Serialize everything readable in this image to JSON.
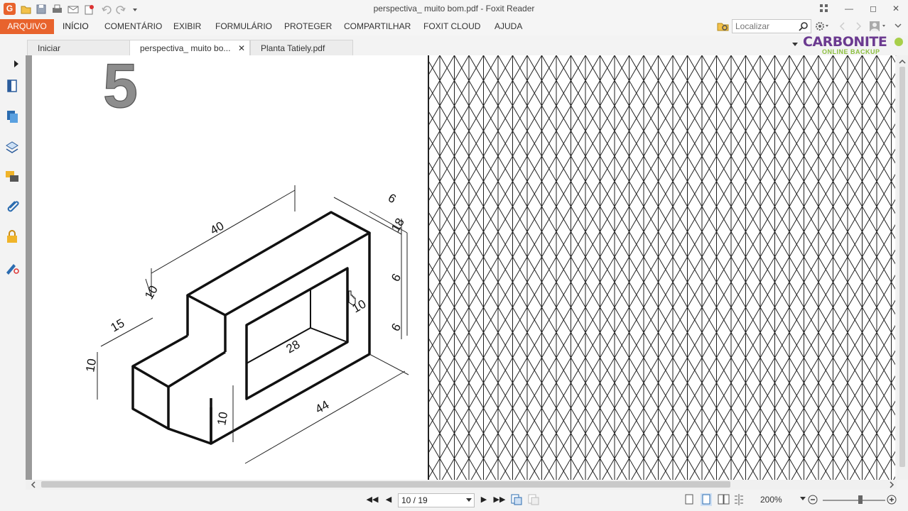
{
  "window": {
    "title": "perspectiva_ muito bom.pdf - Foxit Reader",
    "app_logo_letter": "G",
    "minimize_icon": "minimize-icon",
    "maximize_icon": "maximize-icon",
    "close_icon": "close-icon"
  },
  "menu": {
    "items": [
      "ARQUIVO",
      "INÍCIO",
      "COMENTÁRIO",
      "EXIBIR",
      "FORMULÁRIO",
      "PROTEGER",
      "COMPARTILHAR",
      "FOXIT CLOUD",
      "AJUDA"
    ],
    "search_placeholder": "Localizar"
  },
  "tabs": [
    {
      "label": "Iniciar",
      "active": false
    },
    {
      "label": "perspectiva_ muito bo...",
      "active": true
    },
    {
      "label": "Planta Tatiely.pdf",
      "active": false
    }
  ],
  "ad": {
    "name": "CARBONITE",
    "sub": "ONLINE BACKUP"
  },
  "document": {
    "exercise_number": "5",
    "dimensions": [
      "40",
      "10",
      "6",
      "18",
      "6",
      "6",
      "10",
      "15",
      "10",
      "28",
      "10",
      "44"
    ]
  },
  "statusbar": {
    "page_value": "10 / 19",
    "zoom": "200%"
  },
  "colors": {
    "accent": "#e8632d",
    "carbonite_purple": "#6b3a90",
    "carbonite_green": "#8cbf3f"
  }
}
